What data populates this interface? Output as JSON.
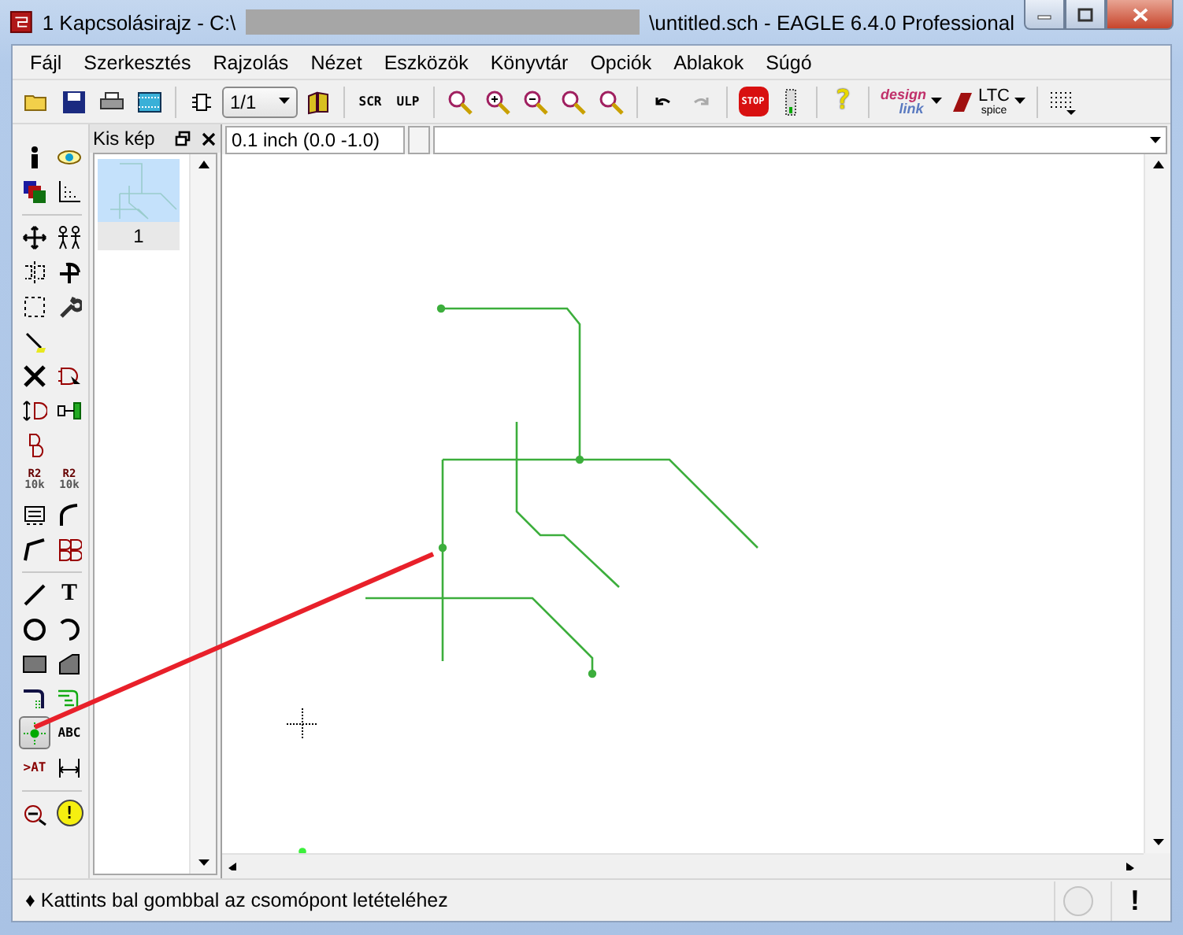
{
  "window": {
    "title_start": "1 Kapcsolásirajz - C:\\",
    "title_end": "\\untitled.sch - EAGLE 6.4.0 Professional"
  },
  "menu": [
    "Fájl",
    "Szerkesztés",
    "Rajzolás",
    "Nézet",
    "Eszközök",
    "Könyvtár",
    "Opciók",
    "Ablakok",
    "Súgó"
  ],
  "toolbar": {
    "page_select": "1/1",
    "script_glyph": "SCR",
    "ulp_glyph": "ULP",
    "stop_glyph": "STOP",
    "help_glyph": "?",
    "design_link": {
      "top": "design",
      "bottom": "link"
    },
    "ltc": {
      "top": "LTC",
      "bottom": "spice"
    },
    "history": [
      {
        "kind": "undo",
        "disabled": false
      },
      {
        "kind": "redo",
        "disabled": true
      }
    ]
  },
  "tools": [
    {
      "selected": false
    },
    {
      "selected": false
    },
    {
      "selected": false
    },
    {
      "selected": false
    },
    {
      "selected": false
    },
    {
      "selected": false
    },
    {
      "selected": false
    },
    {
      "selected": false
    },
    {
      "selected": false
    },
    {
      "selected": false
    },
    {
      "selected": false
    },
    {
      "selected": false
    },
    {
      "selected": false
    },
    {
      "selected": false
    },
    {
      "selected": false
    },
    {
      "selected": false
    },
    {
      "selected": false,
      "glyph": "R2",
      "sub": "10k"
    },
    {
      "selected": false,
      "glyph": "R2",
      "sub": "10k"
    },
    {
      "selected": false
    },
    {
      "selected": false
    },
    {
      "selected": false
    },
    {
      "selected": false
    },
    {
      "selected": false
    },
    {
      "selected": false,
      "glyph": "T"
    },
    {
      "selected": false
    },
    {
      "selected": false
    },
    {
      "selected": false
    },
    {
      "selected": false
    },
    {
      "selected": false
    },
    {
      "selected": false
    },
    {
      "selected": true
    },
    {
      "selected": false,
      "glyph": "ABC"
    },
    {
      "selected": false,
      "glyph": ">AT"
    },
    {
      "selected": false
    },
    {
      "selected": false
    },
    {
      "selected": false,
      "glyph": "!"
    }
  ],
  "thumbnail_panel": {
    "title": "Kis kép",
    "pages": [
      {
        "label": "1",
        "selected": true
      }
    ]
  },
  "coordinates": "0.1 inch (0.0 -1.0)",
  "status_bar": {
    "marker": "♦",
    "message": "Kattints bal gombbal az csomópont letételéhez",
    "alert_glyph": "!"
  }
}
